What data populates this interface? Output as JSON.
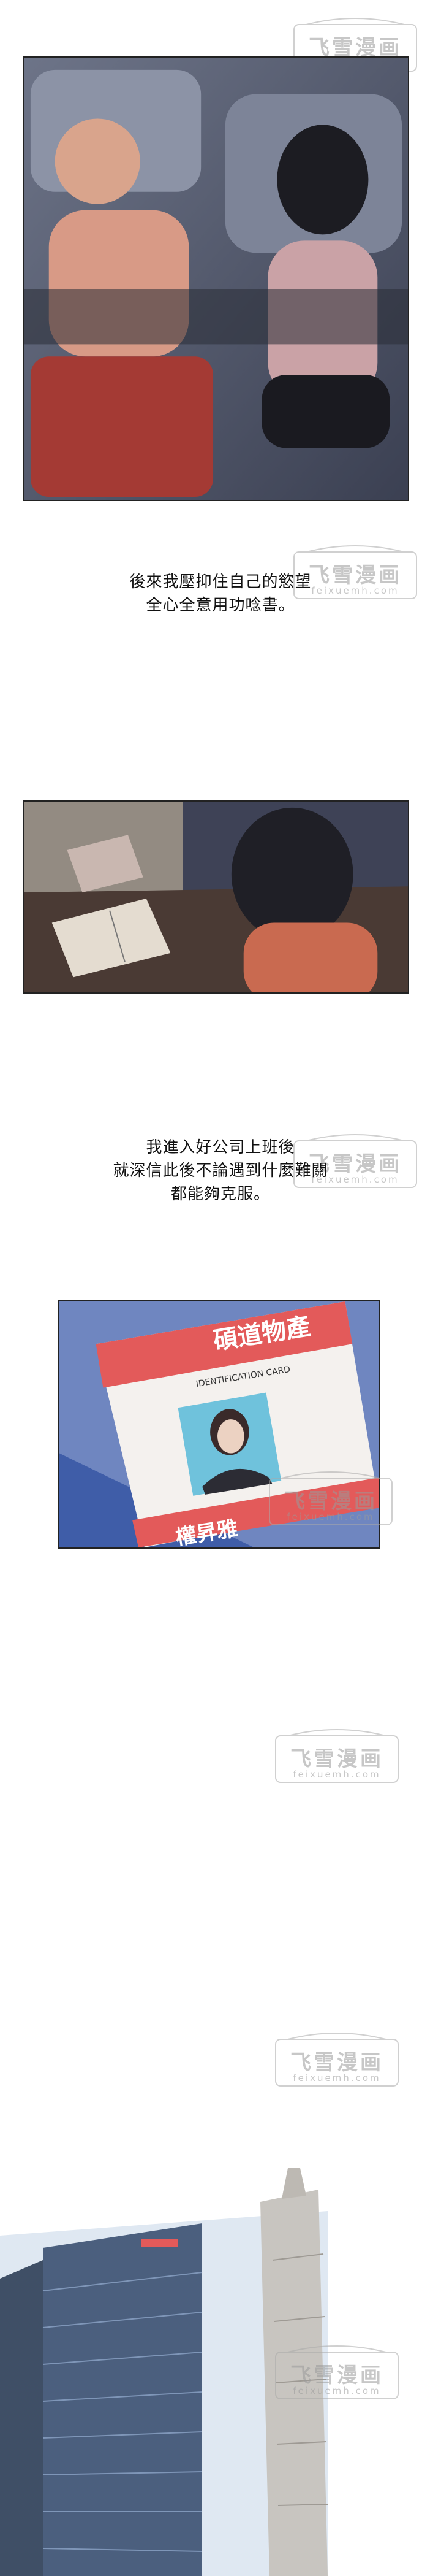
{
  "watermark": {
    "title": "飞雪漫画",
    "subtitle": "feixuemh.com"
  },
  "captions": {
    "c1_line1": "後來我壓抑住自己的慾望",
    "c1_line2": "全心全意用功唸書。",
    "c2_line1": "我進入好公司上班後",
    "c2_line2": "就深信此後不論遇到什麼難關",
    "c2_line3": "都能夠克服。"
  },
  "id_card": {
    "company": "碩道物產",
    "label": "IDENTIFICATION CARD",
    "name": "權昇雅"
  },
  "colors": {
    "accent_red": "#e35a5a",
    "panel_border": "#222222",
    "watermark": "#9a9a9a"
  }
}
